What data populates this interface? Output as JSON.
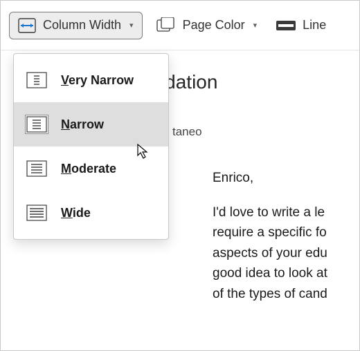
{
  "toolbar": {
    "column_width_label": "Column Width",
    "page_color_label": "Page Color",
    "line_label": "Line"
  },
  "menu": {
    "items": [
      {
        "label_pre": "",
        "label_u": "V",
        "label_post": "ery Narrow"
      },
      {
        "label_pre": "",
        "label_u": "N",
        "label_post": "arrow"
      },
      {
        "label_pre": "",
        "label_u": "M",
        "label_post": "oderate"
      },
      {
        "label_pre": "",
        "label_u": "W",
        "label_post": "ide"
      }
    ],
    "selected_index": 1
  },
  "document": {
    "title_fragment": "endation",
    "from_fragment": "taneo",
    "greeting": "Enrico,",
    "body": "I'd love to write a le\nrequire a specific fo\naspects of your edu\ngood idea to look at\nof the types of cand"
  }
}
